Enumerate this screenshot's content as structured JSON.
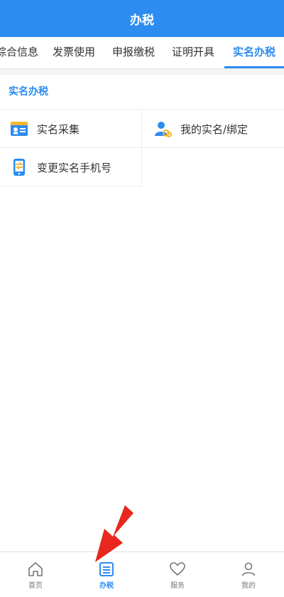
{
  "header": {
    "title": "办税"
  },
  "tabs": [
    {
      "label": "综合信息"
    },
    {
      "label": "发票使用"
    },
    {
      "label": "申报缴税"
    },
    {
      "label": "证明开具"
    },
    {
      "label": "实名办税",
      "active": true
    }
  ],
  "section": {
    "title": "实名办税",
    "items": [
      {
        "label": "实名采集",
        "icon": "id-card-icon"
      },
      {
        "label": "我的实名/绑定",
        "icon": "user-link-icon"
      },
      {
        "label": "变更实名手机号",
        "icon": "phone-swap-icon"
      }
    ]
  },
  "tabbar": {
    "items": [
      {
        "label": "首页",
        "icon": "home-icon"
      },
      {
        "label": "办税",
        "icon": "list-doc-icon",
        "active": true
      },
      {
        "label": "服务",
        "icon": "heart-icon"
      },
      {
        "label": "我的",
        "icon": "person-icon"
      }
    ]
  },
  "colors": {
    "primary": "#2d8cf0",
    "annotation_arrow": "#e8281e"
  }
}
